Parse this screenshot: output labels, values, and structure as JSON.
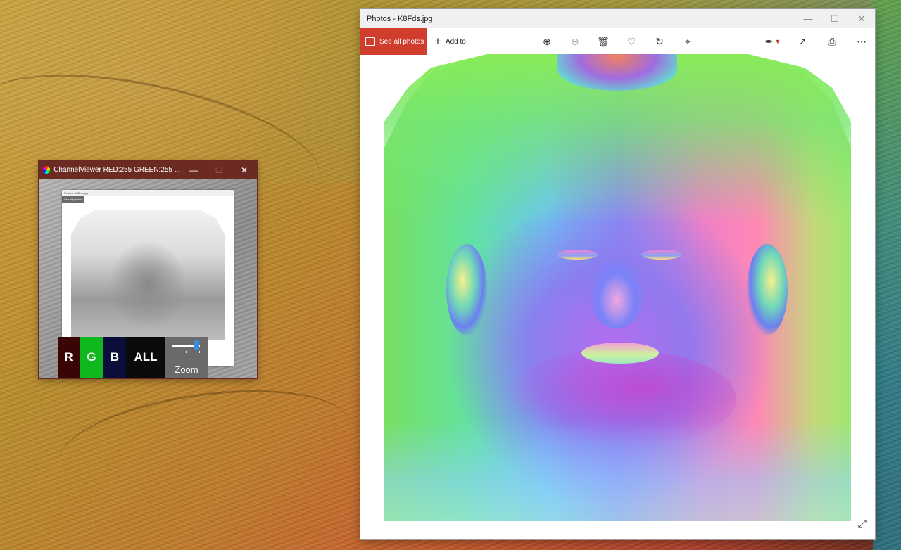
{
  "photos_window": {
    "title": "Photos - K8Fds.jpg",
    "see_all_label": "See all photos",
    "add_to_label": "Add to",
    "accent": "#d13d2c",
    "icons": [
      "zoom-in-icon",
      "zoom-out-icon",
      "delete-icon",
      "favorite-icon",
      "rotate-icon",
      "crop-icon",
      "edit-icon",
      "share-icon",
      "print-icon",
      "more-icon"
    ]
  },
  "channel_viewer": {
    "title": "ChannelViewer    RED:255   GREEN:255 ...",
    "buttons": [
      {
        "label": "R",
        "color": "#3a0505"
      },
      {
        "label": "G",
        "color": "#10b820"
      },
      {
        "label": "B",
        "color": "#0a0e3a"
      },
      {
        "label": "ALL",
        "color": "#0a0a0a"
      }
    ],
    "zoom_label": "Zoom",
    "zoom_level": 0.85,
    "title_color": "#6b2a22"
  }
}
